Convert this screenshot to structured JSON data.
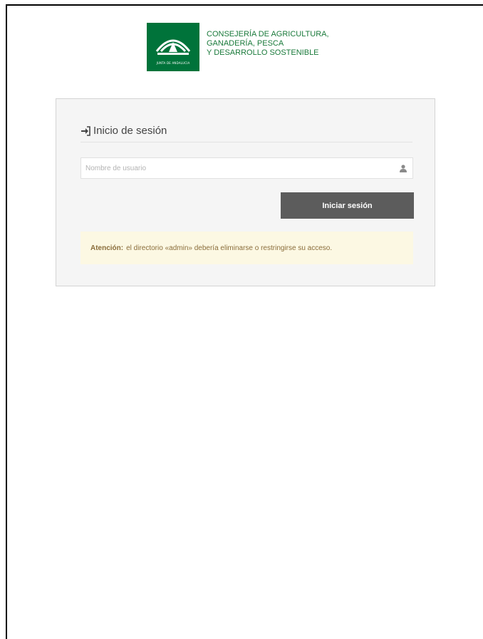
{
  "header": {
    "seal_text": "JUNTA DE ANDALUCIA",
    "org_name_lines": [
      "CONSEJERÍA DE AGRICULTURA,",
      "GANADERÍA, PESCA",
      "Y DESARROLLO SOSTENIBLE"
    ]
  },
  "login": {
    "title": "Inicio de sesión",
    "username_placeholder": "Nombre de usuario",
    "username_value": "",
    "submit_label": "Iniciar sesión"
  },
  "alert": {
    "label": "Atención:",
    "message": "el directorio «admin» debería eliminarse o restringirse su acceso."
  },
  "colors": {
    "brand_green": "#00733a",
    "button": "#5c5c5c",
    "alert_bg": "#fcf8e3",
    "alert_text": "#8a6d3b"
  },
  "icons": {
    "title_icon": "sign-in-icon",
    "input_icon": "user-icon"
  }
}
